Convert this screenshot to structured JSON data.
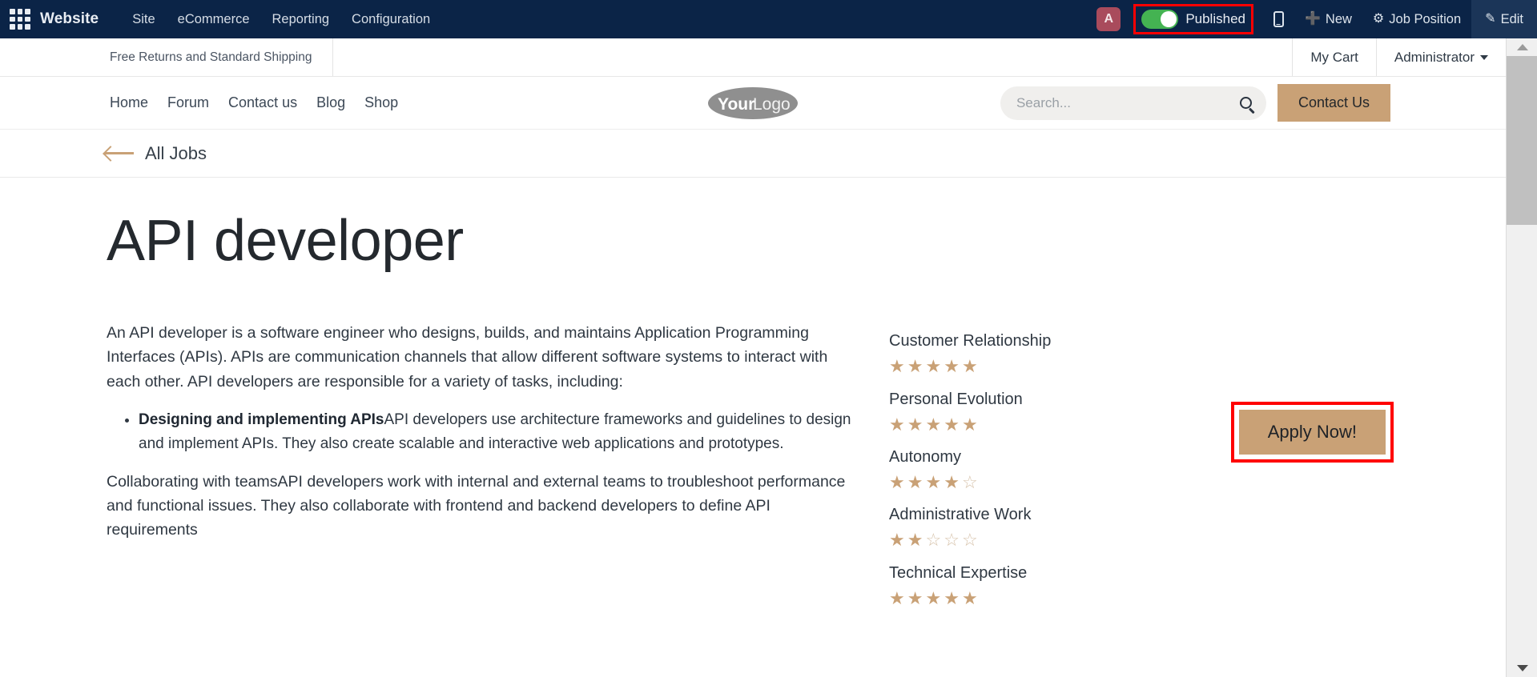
{
  "backoffice": {
    "grid_icon": "apps-grid-icon",
    "brand": "Website",
    "menu": [
      "Site",
      "eCommerce",
      "Reporting",
      "Configuration"
    ],
    "avatar_initial": "A",
    "published_label": "Published",
    "published_state": "on",
    "mobile_preview_icon": "mobile-phone-icon",
    "new_label": "New",
    "new_icon": "plus-icon",
    "job_position_label": "Job Position",
    "job_position_icon": "gear-icon",
    "edit_label": "Edit",
    "edit_icon": "pencil-icon",
    "navbar_color": "#0b2447",
    "highlight_color": "#ff0000"
  },
  "topbar": {
    "promo_text": "Free Returns and Standard Shipping",
    "my_cart": "My Cart",
    "account": "Administrator"
  },
  "nav": {
    "links": [
      "Home",
      "Forum",
      "Contact us",
      "Blog",
      "Shop"
    ],
    "logo_primary": "Your",
    "logo_secondary": "Logo",
    "search_placeholder": "Search...",
    "search_value": "",
    "search_icon": "magnifier-icon",
    "contact_button": "Contact Us",
    "accent_color": "#c9a176"
  },
  "breadcrumb": {
    "back_label": "All Jobs",
    "back_icon": "arrow-left-icon"
  },
  "job": {
    "title": "API developer",
    "apply_button": "Apply Now!",
    "intro": "An API developer is a software engineer who designs, builds, and maintains Application Programming Interfaces (APIs). APIs are communication channels that allow different software systems to interact with each other. API developers are responsible for a variety of tasks, including:",
    "bullets": [
      {
        "bold": "Designing and implementing APIs",
        "rest": "API developers use architecture frameworks and guidelines to design and implement APIs. They also create scalable and interactive web applications and prototypes."
      }
    ],
    "paragraph2": "Collaborating with teamsAPI developers work with internal and external teams to troubleshoot performance and functional issues. They also collaborate with frontend and backend developers to define API requirements"
  },
  "ratings": [
    {
      "name": "Customer Relationship",
      "value": 5,
      "max": 5
    },
    {
      "name": "Personal Evolution",
      "value": 5,
      "max": 5
    },
    {
      "name": "Autonomy",
      "value": 4,
      "max": 5
    },
    {
      "name": "Administrative Work",
      "value": 2,
      "max": 5
    },
    {
      "name": "Technical Expertise",
      "value": 5,
      "max": 5
    }
  ],
  "scrollbar": {
    "up_icon": "scroll-up-arrow",
    "down_icon": "scroll-down-arrow",
    "thumb_position_pct": 0,
    "thumb_size_pct": 28
  }
}
